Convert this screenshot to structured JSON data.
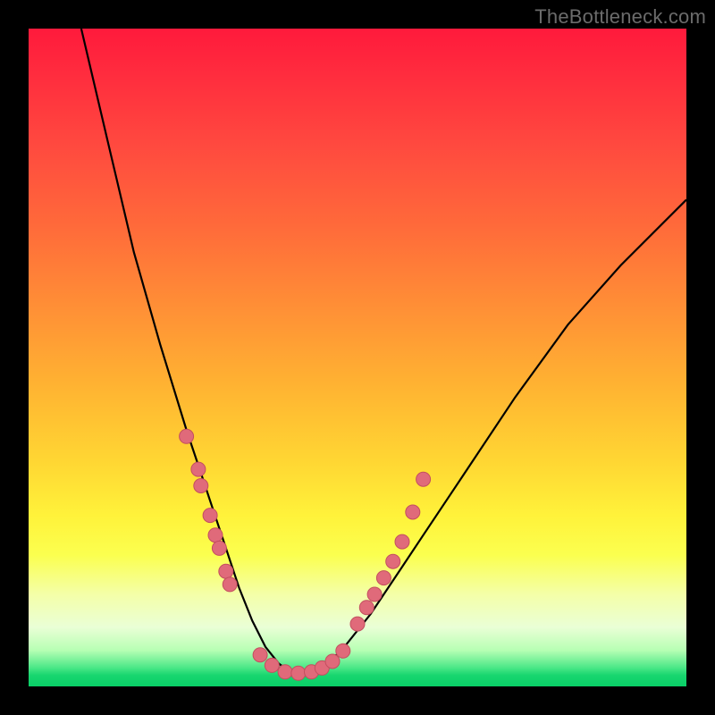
{
  "watermark": "TheBottleneck.com",
  "colors": {
    "frame": "#000000",
    "dot_fill": "#e06a7a",
    "dot_stroke": "#c34e5f",
    "curve": "#000000"
  },
  "chart_data": {
    "type": "line",
    "title": "",
    "xlabel": "",
    "ylabel": "",
    "xlim": [
      0,
      100
    ],
    "ylim": [
      0,
      100
    ],
    "grid": false,
    "legend": false,
    "note": "V-shaped bottleneck curve over vertical spectral gradient (red→yellow→green). Y represents severity/height (100=top, 0=bottom). Minimum plateau near x≈35–45 at y≈2.",
    "series": [
      {
        "name": "bottleneck-curve",
        "x": [
          8,
          12,
          16,
          20,
          24,
          26,
          28,
          30,
          32,
          34,
          36,
          38,
          40,
          42,
          44,
          46,
          48,
          52,
          56,
          60,
          66,
          74,
          82,
          90,
          100
        ],
        "values": [
          100,
          83,
          66,
          52,
          39,
          33,
          27,
          21,
          15,
          10,
          6,
          3.5,
          2,
          2,
          2.5,
          4,
          6,
          11,
          17,
          23,
          32,
          44,
          55,
          64,
          74
        ]
      }
    ],
    "scatter": [
      {
        "name": "dots-left-cluster",
        "x": [
          24.0,
          25.8,
          26.2,
          27.6,
          28.4,
          29.0,
          30.0,
          30.6
        ],
        "values": [
          38.0,
          33.0,
          30.5,
          26.0,
          23.0,
          21.0,
          17.5,
          15.5
        ]
      },
      {
        "name": "dots-bottom-plateau",
        "x": [
          35.2,
          37.0,
          39.0,
          41.0,
          43.0,
          44.6,
          46.2,
          47.8
        ],
        "values": [
          4.8,
          3.2,
          2.2,
          2.0,
          2.2,
          2.8,
          3.8,
          5.4
        ]
      },
      {
        "name": "dots-right-cluster",
        "x": [
          50.0,
          51.4,
          52.6,
          54.0,
          55.4,
          56.8,
          58.4,
          60.0
        ],
        "values": [
          9.5,
          12.0,
          14.0,
          16.5,
          19.0,
          22.0,
          26.5,
          31.5
        ]
      }
    ]
  }
}
